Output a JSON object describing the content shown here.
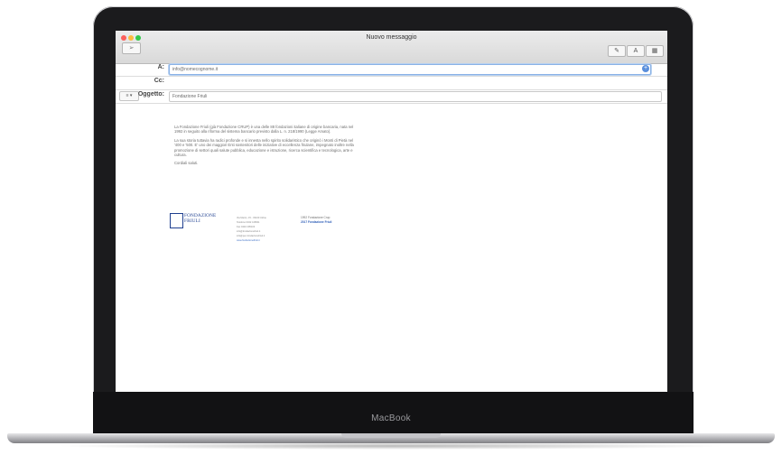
{
  "device": {
    "brand": "MacBook"
  },
  "window": {
    "title": "Nuovo messaggio"
  },
  "toolbar": {
    "send_icon": "send-arrow",
    "buttons": [
      {
        "name": "attach-icon",
        "glyph": "✎"
      },
      {
        "name": "font-icon",
        "glyph": "A"
      },
      {
        "name": "photo-icon",
        "glyph": "▦"
      },
      {
        "name": "format-icon",
        "glyph": "▤"
      }
    ]
  },
  "fields": {
    "to_label": "A:",
    "to_value": "info@nomecognome.it",
    "cc_label": "Cc:",
    "cc_value": "",
    "subject_label": "Oggetto:",
    "subject_value": "Fondazione Friuli",
    "format_button": "≡ ▾"
  },
  "body": {
    "paragraphs": [
      "La Fondazione Friuli (già Fondazione CRUP) è una delle 88 fondazioni italiane di origine bancaria, nata nel 1992 in seguito alla riforma del sistema bancario previsto dalla L. n. 218/1990 (Legge Amato).",
      "La sua storia tuttavia ha radici profonde e si innesta nello spirito solidaristico che originò i Monti di Pietà nel '400 e '500. E' uno dei maggiori Enti sostenitori delle iniziative di eccellenza friulane, impegnato inoltre nella promozione di settori quali salute pubblica, educazione e istruzione, ricerca scientifica e tecnologica, arte e cultura.",
      "Cordiali saluti."
    ]
  },
  "signature": {
    "logo_line1": "FONDAZIONE",
    "logo_line2": "FRIULI",
    "contact": [
      "Via Manin, 15 - 33100 Udine",
      "Telefono 0432 415811",
      "Fax 0432 295103",
      "info@fondazionefriuli.it",
      "info@pec.fondazionefriuli.it",
      "www.fondazionefriuli.it"
    ],
    "history_line1": "1992 Fondazione Crup",
    "history_line2": "2017 Fondazione Friuli"
  }
}
